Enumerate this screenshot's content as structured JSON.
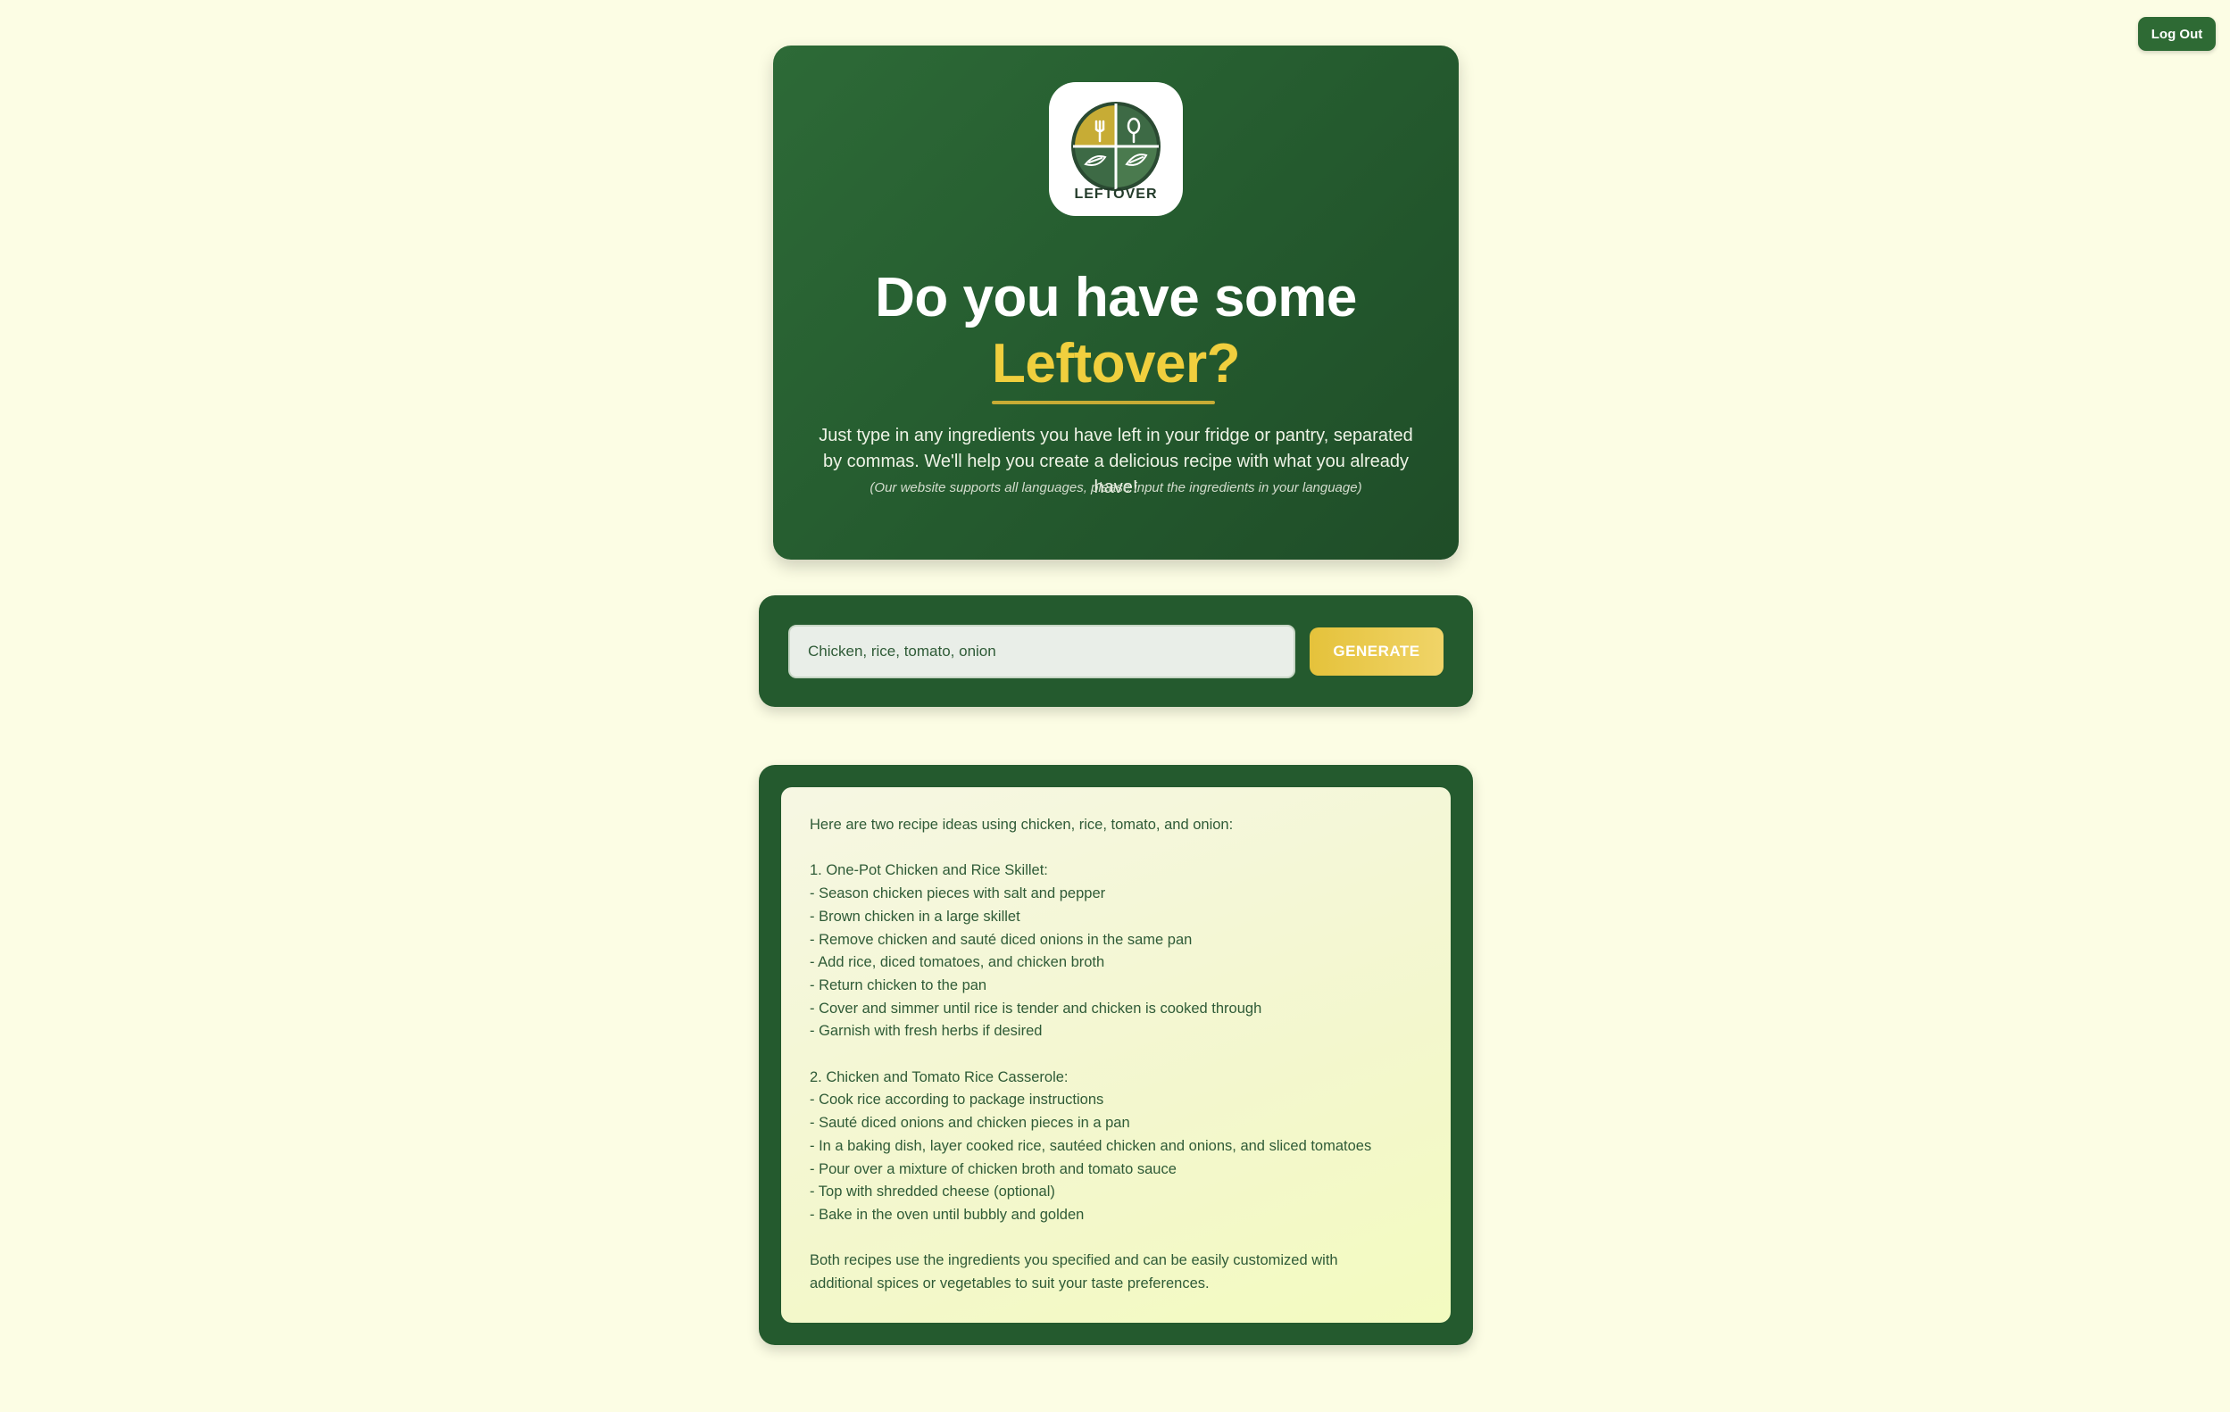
{
  "header": {
    "logout_label": "Log Out"
  },
  "hero": {
    "logo_text": "LEFTOVER",
    "title_line1": "Do you have some",
    "title_line2": "Leftover?",
    "description": "Just type in any ingredients you have left in your fridge or pantry, separated by commas. We'll help you create a delicious recipe with what you already have!",
    "note": "(Our website supports all languages, please input the ingredients in your language)"
  },
  "input": {
    "value": "Chicken, rice, tomato, onion",
    "placeholder": "Chicken, rice, tomato, onion",
    "button_label": "GENERATE"
  },
  "result": {
    "lines": [
      "Here are two recipe ideas using chicken, rice, tomato, and onion:",
      "",
      "1. One-Pot Chicken and Rice Skillet:",
      "- Season chicken pieces with salt and pepper",
      "- Brown chicken in a large skillet",
      "- Remove chicken and sauté diced onions in the same pan",
      "- Add rice, diced tomatoes, and chicken broth",
      "- Return chicken to the pan",
      "- Cover and simmer until rice is tender and chicken is cooked through",
      "- Garnish with fresh herbs if desired",
      "",
      "2. Chicken and Tomato Rice Casserole:",
      "- Cook rice according to package instructions",
      "- Sauté diced onions and chicken pieces in a pan",
      "- In a baking dish, layer cooked rice, sautéed chicken and onions, and sliced tomatoes",
      "- Pour over a mixture of chicken broth and tomato sauce",
      "- Top with shredded cheese (optional)",
      "- Bake in the oven until bubbly and golden",
      "",
      "Both recipes use the ingredients you specified and can be easily customized with",
      "additional spices or vegetables to suit your taste preferences."
    ]
  },
  "colors": {
    "background": "#fcfde4",
    "brand_green": "#245a2e",
    "accent_yellow": "#f0cf3e",
    "text_green": "#2f5b37"
  }
}
